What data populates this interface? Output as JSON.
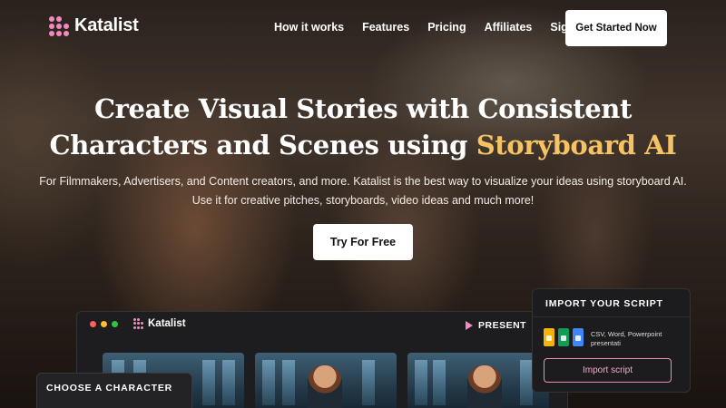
{
  "brand": {
    "name": "Katalist",
    "accent_pink": "#f38bc0",
    "accent_gold": "#f5c264"
  },
  "nav": {
    "links": [
      "How it works",
      "Features",
      "Pricing",
      "Affiliates",
      "Sign in"
    ],
    "cta": "Get Started Now"
  },
  "hero": {
    "title_line1": "Create Visual Stories with Consistent",
    "title_line2_prefix": "Characters and Scenes using ",
    "title_accent": "Storyboard AI",
    "subtitle_line1": "For Filmmakers, Advertisers, and Content creators, and more. Katalist is the best way to visualize your ideas using storyboard AI.",
    "subtitle_line2": "Use it for creative pitches, storyboards, video ideas and much more!",
    "cta": "Try For Free"
  },
  "app_window": {
    "logo": "Katalist",
    "present_label": "PRESENT",
    "window_dot_colors": [
      "#ff5f57",
      "#febc2e",
      "#28c840"
    ]
  },
  "choose_panel": {
    "title": "CHOOSE A CHARACTER"
  },
  "import_panel": {
    "title": "IMPORT  YOUR SCRIPT",
    "formats": "CSV, Word, Powerpoint presentati",
    "button": "Import script",
    "file_icons": [
      {
        "name": "google-slides-icon",
        "color": "#f4b400"
      },
      {
        "name": "google-sheets-icon",
        "color": "#0f9d58"
      },
      {
        "name": "google-docs-icon",
        "color": "#4285f4"
      }
    ]
  }
}
